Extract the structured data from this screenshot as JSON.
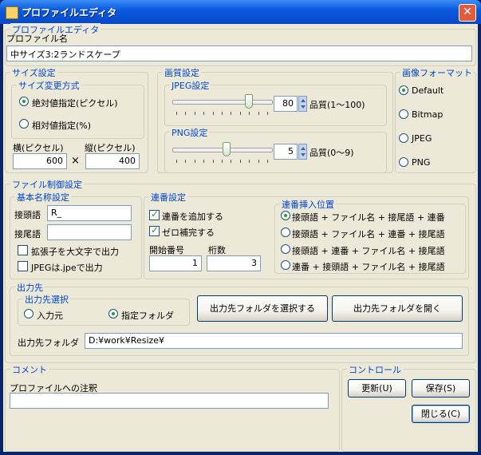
{
  "window": {
    "title": "プロファイルエディタ",
    "close_glyph": "✕"
  },
  "profile": {
    "group_label": "プロファイルエディタ",
    "name_label": "プロファイル名",
    "name_value": "中サイズ3:2ランドスケープ"
  },
  "size": {
    "group_label": "サイズ設定",
    "method_label": "サイズ変更方式",
    "absolute_label": "絶対値指定(ピクセル)",
    "relative_label": "相対値指定(%)",
    "width_label": "横(ピクセル)",
    "height_label": "縦(ピクセル)",
    "width_value": "600",
    "height_value": "400",
    "times_glyph": "×",
    "selected": "absolute"
  },
  "quality": {
    "group_label": "画質設定",
    "jpeg_label": "JPEG設定",
    "jpeg_value": "80",
    "jpeg_range_label": "品質(1〜100)",
    "png_label": "PNG設定",
    "png_value": "5",
    "png_range_label": "品質(0〜9)",
    "jpeg_slider_fraction": 0.8,
    "png_slider_fraction": 0.556
  },
  "format": {
    "group_label": "画像フォーマット",
    "options": [
      "Default",
      "Bitmap",
      "JPEG",
      "PNG"
    ],
    "selected": "Default"
  },
  "file_control": {
    "group_label": "ファイル制御設定",
    "basename": {
      "group_label": "基本名称設定",
      "prefix_label": "接頭語",
      "prefix_value": "R_",
      "suffix_label": "接尾語",
      "suffix_value": "",
      "uppercase_ext_label": "拡張子を大文字で出力",
      "jpeg_ext_label": "JPEGは.jpeで出力"
    },
    "sequence": {
      "group_label": "連番設定",
      "add_seq_label": "連番を追加する",
      "zero_pad_label": "ゼロ補完する",
      "start_label": "開始番号",
      "start_value": "1",
      "digits_label": "桁数",
      "digits_value": "3"
    },
    "seq_position": {
      "group_label": "連番挿入位置",
      "options": [
        "接頭語 + ファイル名 + 接尾語 + 連番",
        "接頭語 + ファイル名 + 連番 + 接尾語",
        "接頭語 + 連番 + ファイル名 + 接尾語",
        "連番 + 接頭語 + ファイル名 + 接尾語"
      ],
      "selected_index": 0
    },
    "output": {
      "group_label": "出力先",
      "select_label": "出力先選択",
      "source_label": "入力元",
      "folder_label": "指定フォルダ",
      "selected": "folder",
      "choose_button": "出力先フォルダを選択する",
      "open_button": "出力先フォルダを開く",
      "folder_field_label": "出力先フォルダ",
      "folder_value": "D:¥work¥Resize¥"
    }
  },
  "comment": {
    "group_label": "コメント",
    "note_label": "プロファイルへの注釈",
    "note_value": ""
  },
  "control": {
    "group_label": "コントロール",
    "update_button": "更新(U)",
    "save_button": "保存(S)",
    "close_button": "閉じる(C)"
  }
}
